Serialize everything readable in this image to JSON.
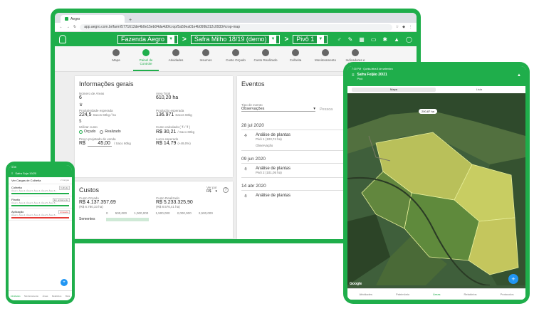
{
  "desktop": {
    "browser_tab": "Aegro",
    "url": "app.aegro.com.br/farm/5771612de4b0e15eb04da4d0/crop/5a59ea01e4b099b312c0933#crop-map",
    "farm": "Fazenda Aegro",
    "crop": "Safra Milho 18/19 (demo)",
    "plot": "Pivô 1",
    "nav": [
      "Mapa",
      "Painel de Controle",
      "Atividades",
      "Insumos",
      "Custo Orçado",
      "Custo Realizado",
      "Colheita",
      "Monitoramento",
      "Indicadores e Relatórios"
    ],
    "general": {
      "title": "Informações gerais",
      "plots_label": "Número de Áreas",
      "plots_value": "6",
      "total_area_label": "Área Total",
      "total_area_value": "610,20 ha",
      "expected_productivity_label": "Produtividade esperada",
      "expected_productivity_value": "224,5",
      "expected_productivity_unit": "Sacos 60kg / ha",
      "expected_production_label": "Produção esperada",
      "expected_production_value": "136.971",
      "expected_production_unit": "Sacos 60kg",
      "use_cost_label": "Utilizar custo",
      "budgeted_option": "Orçado",
      "realized_option": "Realizado",
      "calc_cost_label": "Custo calculado ( ₹ / ₹ )",
      "calc_cost_value": "R$ 30,21",
      "calc_cost_unit": "/ Saco 60kg",
      "sale_price_label": "Preço projetado de venda",
      "sale_price_currency": "R$",
      "sale_price_value": "45,00",
      "sale_price_unit": "/ Saco 60kg",
      "expected_profit_label": "Lucro esperado",
      "expected_profit_value": "R$ 14,79",
      "expected_profit_pct": "(+49,0%)"
    },
    "costs": {
      "title": "Custos",
      "view_label": "Ver por",
      "view_value": "R$",
      "budget_label": "Custo Orçado",
      "budget_value": "R$ 4.137.357,69",
      "budget_per_ha": "(R$ 6.780,33 ha)",
      "realized_label": "Custo Realizado",
      "realized_value": "R$ 5.233.325,90",
      "realized_per_ha": "(R$ 8.576,41 ha)",
      "axis_ticks": [
        "0",
        "500,000",
        "1,000,000",
        "1,500,000",
        "2,000,000",
        "2,500,000"
      ],
      "first_row": "Sementes"
    },
    "events": {
      "title": "Eventos",
      "type_label": "Tipo de evento",
      "type_value": "Observações",
      "search_placeholder": "Pessoa",
      "items": [
        {
          "date": "28 jul 2020",
          "title": "Análise de plantas",
          "plot": "Pivô 1 (103,74 ha)",
          "note": "Observação"
        },
        {
          "date": "09 jun 2020",
          "title": "Análise de plantas",
          "plot": "Pivô 2 (101,05 ha)",
          "note": ""
        },
        {
          "date": "14 abr 2020",
          "title": "Análise de plantas",
          "plot": "",
          "note": ""
        }
      ]
    }
  },
  "phone": {
    "time": "3:55",
    "crop": "Safra Soja 19/20",
    "filter": "Ver Cargas de Colheita",
    "filter_count": "2 Cargas",
    "cards": [
      {
        "title": "Colheita",
        "detail": "Área 1, Área 2, Área 3, Área 4, Área 5, Área 6...",
        "badge": "Colheita"
      },
      {
        "title": "Plantio",
        "detail": "Área 1, Área 2, Área 3, Área 4, Área 5, Área 6...",
        "badge": "Em andamento"
      },
      {
        "title": "Aplicação",
        "detail": "Área 1, Área 2, Área 3, Área 4, Área 5, Área 6...",
        "badge": "Atrasada"
      }
    ],
    "tabs": [
      "Atividades",
      "Monitoramento",
      "Áreas",
      "Relatórios",
      "Mais"
    ]
  },
  "tablet": {
    "status": "7:30 PM · Quinta-feira 8 de setembro",
    "crop": "Safra Feijão 20/21",
    "plot": "Pivô",
    "seg_map": "Mapa",
    "seg_list": "Lista",
    "area_tag": "200,87 ha",
    "google": "Google",
    "tabs": [
      "Atividades",
      "Patrimônio",
      "Áreas",
      "Relatórios",
      "Protocolos"
    ]
  }
}
